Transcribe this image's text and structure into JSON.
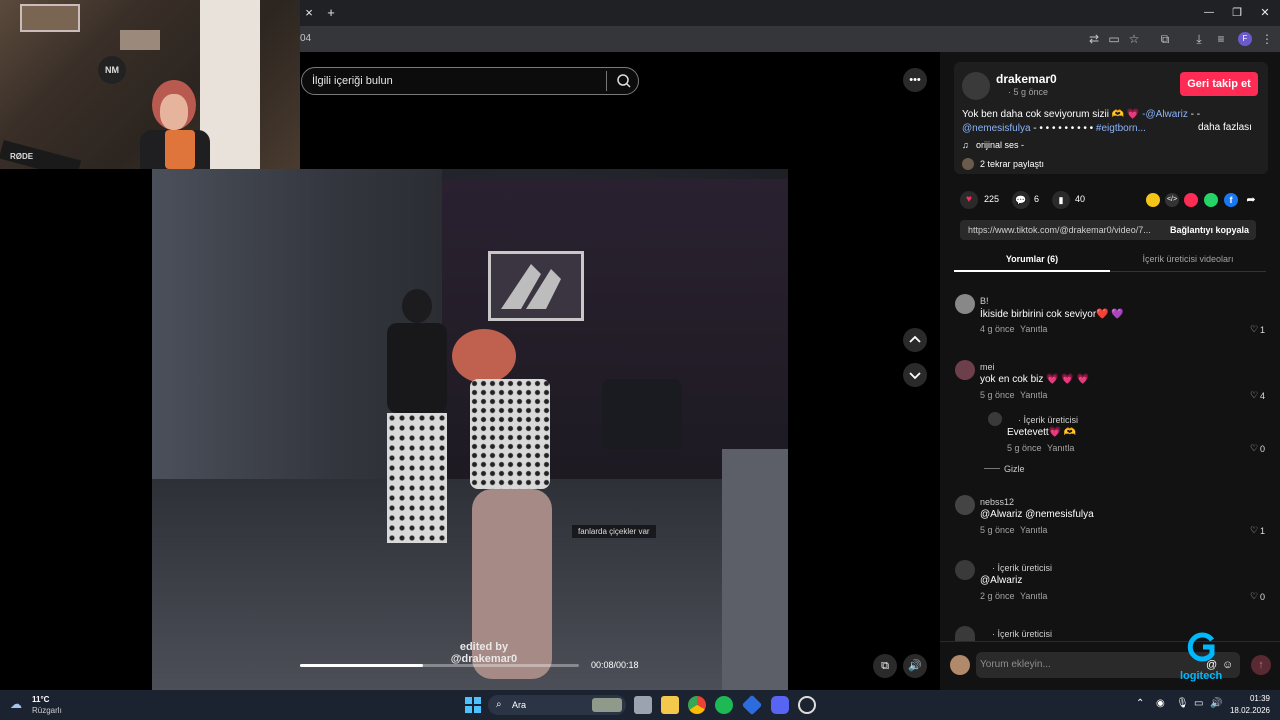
{
  "browser": {
    "add_tab": "+",
    "close_tab": "×",
    "url_fragment": "04",
    "profile_initial": "F",
    "window_controls": {
      "minimize": "—",
      "maximize": "❐",
      "close": "✕"
    }
  },
  "webcam": {
    "mic_label": "RØDE",
    "logo_text": "NM"
  },
  "search": {
    "placeholder": "İlgili içeriği bulun"
  },
  "video": {
    "caption_text": "fanlarda çiçekler var",
    "watermark_line1": "edited by",
    "watermark_line2": "@drakemar0",
    "time": "00:08/00:18",
    "progress": 0.44
  },
  "post": {
    "username": "drakemar0",
    "time_ago": "· 5 g önce",
    "follow_button": "Geri takip et",
    "desc_part1": "Yok ben daha cok seviyorum sizii 🫶 💗 ",
    "mention1": "-@Alwariz",
    "desc_part2": " - -",
    "mention2": "@nemesisfulya",
    "desc_part3": " - • • • • • • • • • ",
    "hashtag": "#eigtborn...",
    "more_label": "daha fazlası",
    "sound": "orijinal ses -",
    "reposts": "2 tekrar paylaştı"
  },
  "stats": {
    "likes": "225",
    "comments": "6",
    "saves": "40"
  },
  "share": {
    "url": "https://www.tiktok.com/@drakemar0/video/7...",
    "copy_button": "Bağlantıyı kopyala"
  },
  "tabs": [
    {
      "label": "Yorumlar (6)",
      "active": true
    },
    {
      "label": "İçerik üreticisi videoları",
      "active": false
    }
  ],
  "comments": [
    {
      "name": "B!",
      "text": "İkiside birbirini cok seviyor❤️ 💜",
      "time": "4 g önce",
      "reply": "Yanıtla",
      "likes": "1"
    },
    {
      "name": "mei",
      "text": "yok en cok biz 💗 💗 💗",
      "time": "5 g önce",
      "reply": "Yanıtla",
      "likes": "4"
    },
    {
      "name": "· İçerik üreticisi",
      "text": "Evetevett💗 🫶",
      "time": "5 g önce",
      "reply": "Yanıtla",
      "likes": "0"
    },
    {
      "name": "nebss12",
      "text": "@Alwariz @nemesisfulya",
      "time": "5 g önce",
      "reply": "Yanıtla",
      "likes": "1"
    },
    {
      "name": "· İçerik üreticisi",
      "text": "@Alwariz",
      "time": "2 g önce",
      "reply": "Yanıtla",
      "likes": "0"
    },
    {
      "name": "· İçerik üreticisi",
      "text": "",
      "time": "",
      "reply": "",
      "likes": ""
    }
  ],
  "hide_label": "Gizle",
  "comment_input": {
    "placeholder": "Yorum ekleyin..."
  },
  "logitech": "logitech",
  "taskbar": {
    "weather_temp": "11°C",
    "weather_desc": "Rüzgarlı",
    "search_label": "Ara",
    "time": "01:39",
    "date": "18.02.2026"
  },
  "colors": {
    "accent": "#fe2c55",
    "panel_bg": "#121212",
    "link": "#8ab4f8"
  }
}
